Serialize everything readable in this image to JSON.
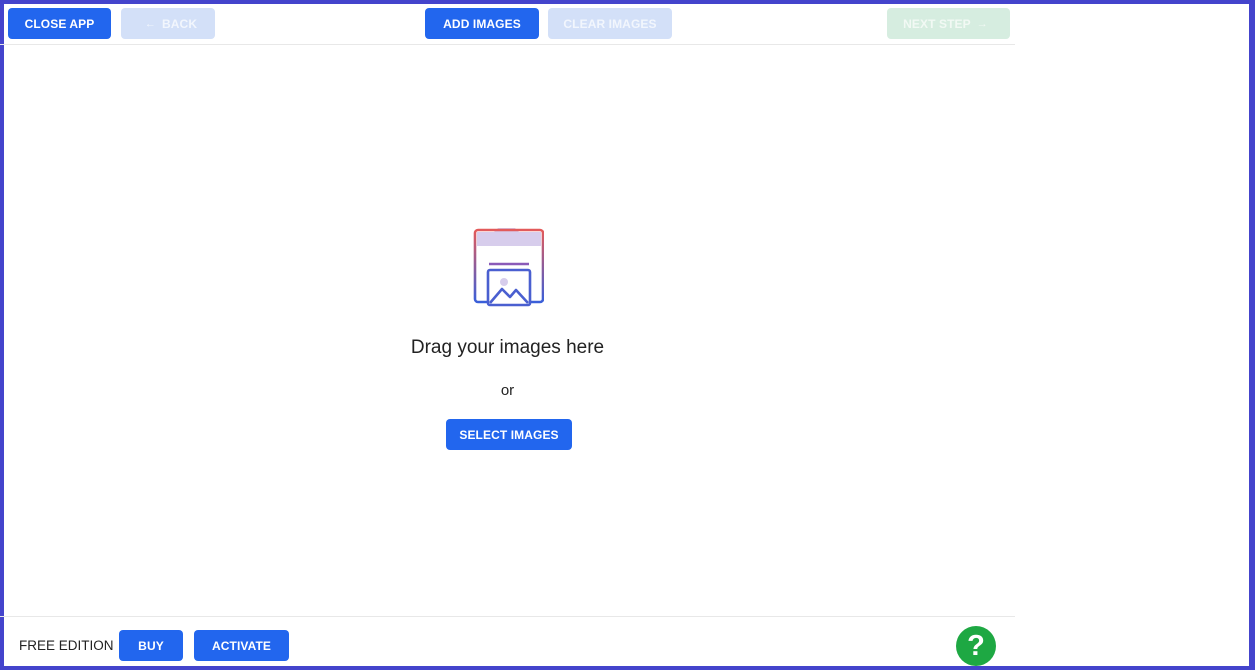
{
  "toolbar": {
    "close_label": "CLOSE APP",
    "back_label": "BACK",
    "add_label": "ADD IMAGES",
    "clear_label": "CLEAR IMAGES",
    "next_label": "NEXT STEP"
  },
  "dropzone": {
    "title": "Drag your images here",
    "or": "or",
    "select_label": "SELECT IMAGES",
    "icon": "folder-image-icon"
  },
  "footer": {
    "edition": "FREE EDITION",
    "buy_label": "BUY",
    "activate_label": "ACTIVATE",
    "help_glyph": "?"
  },
  "colors": {
    "primary": "#2266ee",
    "disabled": "#d3e0f8",
    "next_disabled": "#d6ede0",
    "help": "#1ea843",
    "border": "#4444cc"
  }
}
